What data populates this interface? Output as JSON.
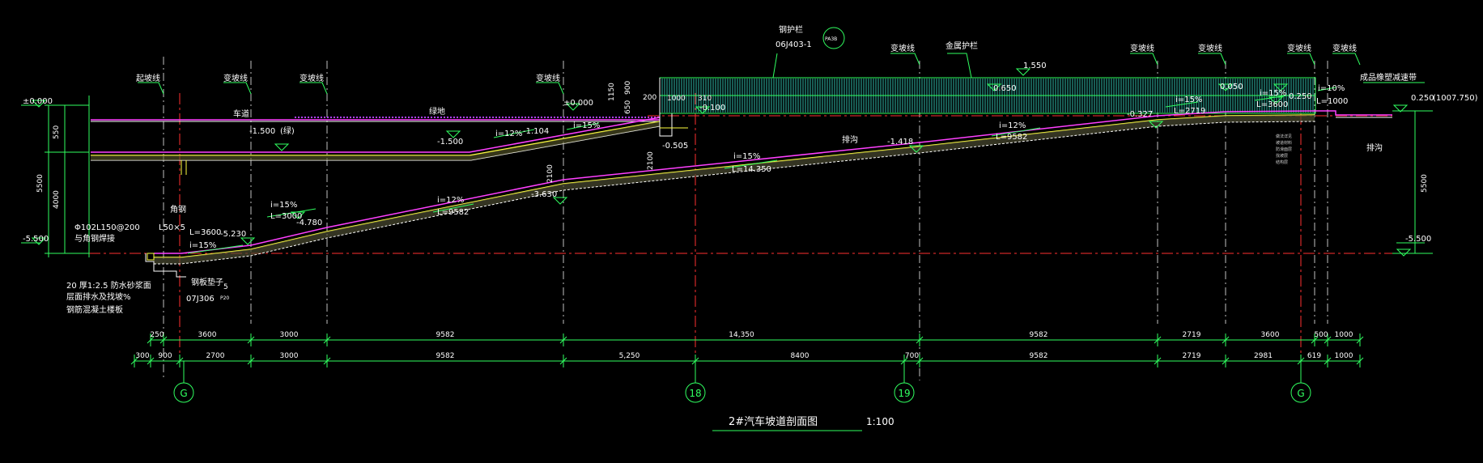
{
  "drawing": {
    "title": "2#汽车坡道剖面图",
    "scale": "1:100"
  },
  "top_callouts": {
    "start_line": "起坡线",
    "grade_change": "变坡线",
    "steel_railing": "钢护栏",
    "steel_railing_ref": "06J403-1",
    "steel_railing_ref_tag": "PA3B",
    "metal_railing": "金属护栏",
    "speed_bump": "成品橡塑减速带"
  },
  "surfaces": {
    "driveway": "车道",
    "landscape": "绿地",
    "trench": "排沟"
  },
  "elevations": {
    "left_top": "±0.000",
    "left_bottom": "-5.500",
    "right_top": "0.250",
    "right_top_abs": "(1007.750)",
    "right_bottom": "-5.500",
    "e_m1500_note": "-1.500",
    "e_m1500_paren": "(绿)",
    "e_m1500_b": "-1.500",
    "e_m1104": "-1.104",
    "e_pm000_mid": "±0.000",
    "e_m0100": "-0.100",
    "e_m0505": "-0.505",
    "e_m3630": "-3.630",
    "e_m4780": "-4.780",
    "e_m5230": "-5.230",
    "e_m1418": "-1.418",
    "e_m0327": "-0.327",
    "e_1550": "1.550",
    "e_0650": "0.650",
    "e_0050": "0.050",
    "e_0250_b": "0.250"
  },
  "slopes": {
    "s1": "i=15%",
    "l1": "L=3600",
    "s2": "i=15%",
    "l2": "L=3000",
    "s3": "i=12%",
    "l3": "L=9582",
    "s4": "i=15%",
    "l4": "L=14.350",
    "s5": "i=12%",
    "l5": "L=9582",
    "s6": "i=15%",
    "l6": "L=2719",
    "s7": "i=15%",
    "l7": "L=3600",
    "s8": "i=10%",
    "l8": "L=1000",
    "s9": "i=12%",
    "s10": "i=15%"
  },
  "left_notes": {
    "steel_angle": "角钢",
    "angle_size": "L50×5",
    "pipe": "Φ102L150@200",
    "pipe2": "与角钢焊接",
    "note1": "20 厚1:2.5 防水砂浆面",
    "note2": "层面排水及找坡%",
    "note3": "钢筋混凝土楼板",
    "note4": "钢板垫子",
    "note_ref": "07J306",
    "detail_no": "5",
    "detail_sheet": "P20"
  },
  "verticals": {
    "v550": "550",
    "v5500": "5500",
    "v4000": "4000",
    "v900": "900",
    "v1150": "1150",
    "v650": "650",
    "v200": "200",
    "v2100": "2100",
    "v2100b": "2100",
    "v5500r": "5500",
    "v310": "310",
    "v100": "1000"
  },
  "dims_row1": [
    "250",
    "3600",
    "3000",
    "9582",
    "14,350",
    "9582",
    "2719",
    "3600",
    "500",
    "1000"
  ],
  "dims_row2": [
    "300",
    "900",
    "2700",
    "3000",
    "9582",
    "5,250",
    "8400",
    "700",
    "9582",
    "2719",
    "2981",
    "619",
    "1000"
  ],
  "grid_labels": [
    "G",
    "18",
    "19",
    "G"
  ],
  "right_notes": [
    "做法详见",
    "坡道材料",
    "防滑面层",
    "找坡层",
    "结构层"
  ]
}
